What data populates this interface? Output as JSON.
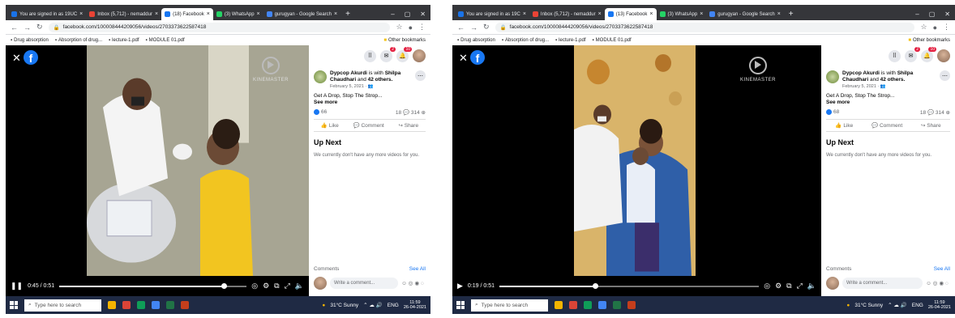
{
  "left": {
    "tabs": [
      {
        "label": "You are signed in as 19UC",
        "color": "#1a73e8",
        "active": false
      },
      {
        "label": "Inbox (5,712) - nemaddur",
        "color": "#ea4335",
        "active": false
      },
      {
        "label": "(18) Facebook",
        "color": "#1877f2",
        "active": true
      },
      {
        "label": "(3) WhatsApp",
        "color": "#25d366",
        "active": false
      },
      {
        "label": "gurugyan - Google Search",
        "color": "#4285f4",
        "active": false
      }
    ],
    "url": "facebook.com/100008444209056/videos/2703373622587418",
    "bookmarks": [
      "Drug absorption",
      "Absorption of drug...",
      "lecture-1.pdf",
      "MODULE 01.pdf"
    ],
    "other_bookmarks": "Other bookmarks",
    "video": {
      "watermark": "KINEMASTER",
      "time": "0:45 / 0:51",
      "progress": 0.88
    },
    "post": {
      "author": "Dypcop Akurdi",
      "with_text": "is with",
      "tagged": "Shilpa Chaudhari",
      "and_text": "and",
      "others": "42 others.",
      "date": "February 5, 2021",
      "description": "Get A Drop, Stop The Strop...",
      "see_more": "See more",
      "reactions": "66",
      "comments_count": "18",
      "shares": "314",
      "like": "Like",
      "comment": "Comment",
      "share": "Share"
    },
    "up_next": "Up Next",
    "no_more": "We currently don't have any more videos for you.",
    "comments_label": "Comments",
    "see_all": "See All",
    "write_placeholder": "Write a comment...",
    "badges": [
      "2",
      "10"
    ],
    "taskbar": {
      "search": "Type here to search",
      "weather": "31°C Sunny",
      "lang": "ENG",
      "time": "11:59",
      "date": "26-04-2021"
    }
  },
  "right": {
    "tabs": [
      {
        "label": "You are signed in as 19C",
        "color": "#1a73e8",
        "active": false
      },
      {
        "label": "Inbox (5,712) - nemaddur",
        "color": "#ea4335",
        "active": false
      },
      {
        "label": "(13) Facebook",
        "color": "#1877f2",
        "active": true
      },
      {
        "label": "(3) WhatsApp",
        "color": "#25d366",
        "active": false
      },
      {
        "label": "gurugyan - Google Search",
        "color": "#4285f4",
        "active": false
      }
    ],
    "url": "facebook.com/100008444209056/videos/2703373622587418",
    "bookmarks": [
      "Drug absorption",
      "Absorption of drug...",
      "lecture-1.pdf",
      "MODULE 01.pdf"
    ],
    "other_bookmarks": "Other bookmarks",
    "video": {
      "watermark": "KINEMASTER",
      "time": "0:19 / 0:51",
      "progress": 0.37
    },
    "post": {
      "author": "Dypcop Akurdi",
      "with_text": "is with",
      "tagged": "Shilpa Chaudhari",
      "and_text": "and",
      "others": "42 others.",
      "date": "February 5, 2021",
      "description": "Get A Drop, Stop The Strop...",
      "see_more": "See more",
      "reactions": "68",
      "comments_count": "18",
      "shares": "314",
      "like": "Like",
      "comment": "Comment",
      "share": "Share"
    },
    "up_next": "Up Next",
    "no_more": "We currently don't have any more videos for you.",
    "comments_label": "Comments",
    "see_all": "See All",
    "write_placeholder": "Write a comment...",
    "badges": [
      "2",
      "10"
    ],
    "taskbar": {
      "search": "Type here to search",
      "weather": "31°C Sunny",
      "lang": "ENG",
      "time": "11:59",
      "date": "26-04-2021"
    }
  },
  "colors": {
    "fb_blue": "#1877f2",
    "chrome_dark": "#35363a",
    "taskbar": "#1f2a44"
  }
}
